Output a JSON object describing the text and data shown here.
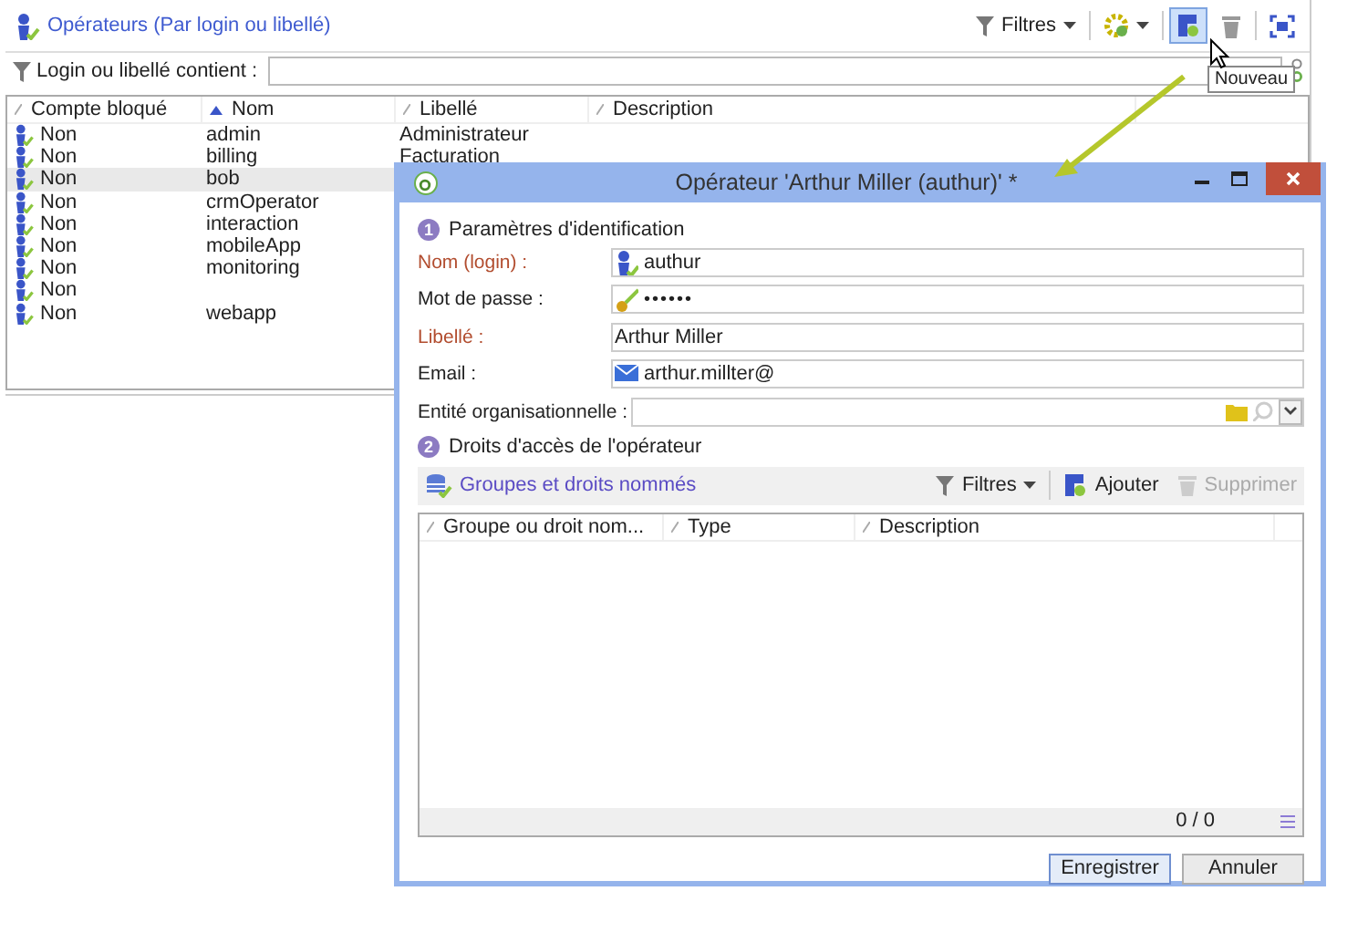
{
  "main": {
    "title": "Opérateurs (Par login ou libellé)",
    "filters": "Filtres",
    "tooltip": "Nouveau",
    "filter": {
      "label": "Login ou libellé contient :"
    },
    "table": {
      "columns": [
        {
          "label": "Compte bloqué",
          "sorted": false
        },
        {
          "label": "Nom",
          "sorted": true
        },
        {
          "label": "Libellé",
          "sorted": false
        },
        {
          "label": "Description",
          "sorted": false
        }
      ],
      "rows": [
        {
          "blocked": "Non",
          "name": "admin",
          "label": "Administrateur",
          "selected": false
        },
        {
          "blocked": "Non",
          "name": "billing",
          "label": "Facturation",
          "selected": false
        },
        {
          "blocked": "Non",
          "name": "bob",
          "selected": true
        },
        {
          "blocked": "Non",
          "name": "crmOperator",
          "selected": false
        },
        {
          "blocked": "Non",
          "name": "interaction",
          "selected": false
        },
        {
          "blocked": "Non",
          "name": "mobileApp",
          "selected": false
        },
        {
          "blocked": "Non",
          "name": "monitoring",
          "selected": false
        },
        {
          "blocked": "Non",
          "selected": false
        },
        {
          "blocked": "Non",
          "name": "webapp",
          "selected": false
        }
      ]
    }
  },
  "dialog": {
    "title": "Opérateur 'Arthur Miller (authur)' *",
    "section_1": {
      "number": "1",
      "title": "Paramètres d'identification"
    },
    "fields": [
      {
        "label": "Nom (login) :",
        "value": "authur",
        "kind": "login",
        "required": true
      },
      {
        "label": "Mot de passe :",
        "value": "••••••",
        "kind": "password",
        "required": false
      },
      {
        "label": "Libellé :",
        "value": "Arthur Miller",
        "kind": "text",
        "required": true
      },
      {
        "label": "Email :",
        "value": "arthur.millter@",
        "kind": "email",
        "required": false
      },
      {
        "label": "Entité organisationnelle :",
        "kind": "lookup",
        "required": false
      }
    ],
    "section_2": {
      "number": "2",
      "title": "Droits d'accès de l'opérateur"
    },
    "rights": {
      "title": "Groupes et droits nommés",
      "filters": "Filtres",
      "add": "Ajouter",
      "delete": {
        "label": "Supprimer",
        "disabled": true
      },
      "columns": [
        "Groupe ou droit nom...",
        "Type",
        "Description"
      ],
      "count": "0 / 0"
    },
    "buttons": [
      {
        "label": "Enregistrer",
        "default": true
      },
      {
        "label": "Annuler",
        "default": false
      }
    ]
  }
}
